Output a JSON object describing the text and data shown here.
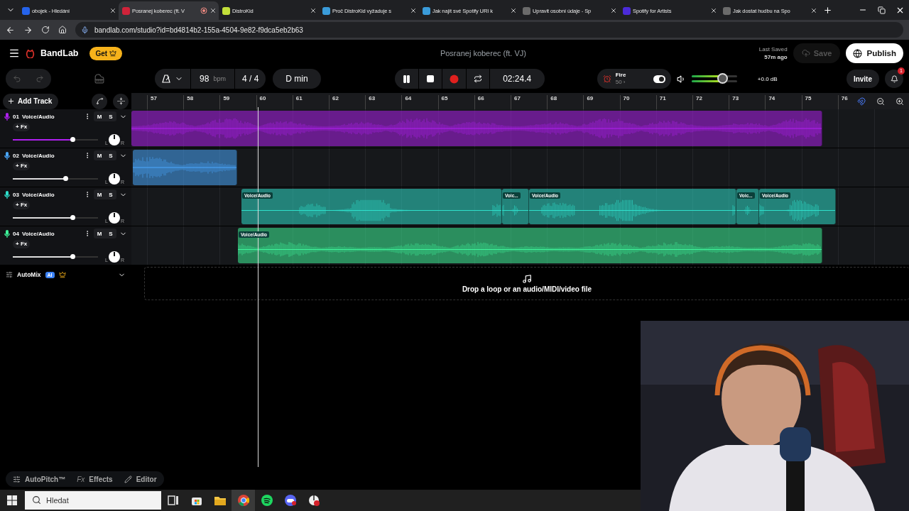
{
  "browser": {
    "tabs": [
      {
        "title": "obojek - Hledání",
        "selected": false,
        "recording": false
      },
      {
        "title": "Posranej koberec (ft. V",
        "selected": true,
        "recording": true
      },
      {
        "title": "DistroKid",
        "selected": false,
        "recording": false
      },
      {
        "title": "Proč DistroKid vyžaduje s",
        "selected": false,
        "recording": false
      },
      {
        "title": "Jak najít své Spotify URI k",
        "selected": false,
        "recording": false
      },
      {
        "title": "Upravit osobní údaje - Sp",
        "selected": false,
        "recording": false
      },
      {
        "title": "Spotify for Artists",
        "selected": false,
        "recording": false
      },
      {
        "title": "Jak dostat hudbu na Spo",
        "selected": false,
        "recording": false
      }
    ],
    "address": "bandlab.com/studio?id=bd4814b2-155a-4504-9e82-f9dca5eb2b63"
  },
  "header": {
    "brand": "BandLab",
    "get_label": "Get",
    "project_title": "Posranej koberec (ft. VJ)",
    "last_saved_label": "Last Saved",
    "last_saved_time": "57m ago",
    "save_label": "Save",
    "save_disabled": true,
    "publish_label": "Publish"
  },
  "transport": {
    "tempo": "98",
    "tempo_unit": "bpm",
    "time_signature": "4 / 4",
    "key": "D min",
    "playing": true,
    "time": "02:24.4",
    "preset": {
      "name": "Fire",
      "value": "50 ›",
      "on": true
    },
    "master": {
      "level": 0.67,
      "reading": "+0.0 dB"
    },
    "invite_label": "Invite",
    "notifications": "1"
  },
  "add_track_label": "Add Track",
  "ruler": [
    "57",
    "58",
    "59",
    "60",
    "61",
    "62",
    "63",
    "64",
    "65",
    "66",
    "67",
    "68",
    "69",
    "70",
    "71",
    "72",
    "73",
    "74",
    "75",
    "76"
  ],
  "tracks": [
    {
      "number": "01",
      "name": "Voice/Audio",
      "fx_label": "+ Fx",
      "mute": "M",
      "solo": "S",
      "pan_left": "L",
      "pan_right": "R",
      "color": "#b020f0",
      "selected": true,
      "level": 0.7,
      "clips": [
        {
          "kind": "plain"
        }
      ]
    },
    {
      "number": "02",
      "name": "Voice/Audio",
      "fx_label": "+ Fx",
      "mute": "M",
      "solo": "S",
      "pan_left": "L",
      "pan_right": "R",
      "color": "#4aa8ff",
      "selected": false,
      "level": 0.62,
      "clips": [
        {
          "kind": "plain"
        }
      ]
    },
    {
      "number": "03",
      "name": "Voice/Audio",
      "fx_label": "+ Fx",
      "mute": "M",
      "solo": "S",
      "pan_left": "L",
      "pan_right": "R",
      "color": "#2ee0cc",
      "selected": false,
      "level": 0.7,
      "clips": [
        {
          "kind": "labeled",
          "label": "Voice/Audio"
        },
        {
          "kind": "labeled",
          "label": "Voic..."
        },
        {
          "kind": "labeled",
          "label": "Voice/Audio"
        },
        {
          "kind": "labeled",
          "label": "Voic..."
        },
        {
          "kind": "labeled",
          "label": "Voice/Audio"
        }
      ]
    },
    {
      "number": "04",
      "name": "Voice/Audio",
      "fx_label": "+ Fx",
      "mute": "M",
      "solo": "S",
      "pan_left": "L",
      "pan_right": "R",
      "color": "#3ef59a",
      "selected": false,
      "level": 0.7,
      "clips": [
        {
          "kind": "labeled",
          "label": "Voice/Audio"
        }
      ]
    }
  ],
  "automix": {
    "label": "AutoMix",
    "badge": "AI"
  },
  "drop_hint": "Drop a loop or an audio/MIDI/video file",
  "bottom_tools": [
    {
      "kind": "autopitch",
      "label": "AutoPitch™"
    },
    {
      "kind": "effects",
      "glyph": "Fx",
      "label": "Effects"
    },
    {
      "kind": "editor",
      "label": "Editor"
    }
  ],
  "taskbar": {
    "search_placeholder": "Hledat"
  }
}
